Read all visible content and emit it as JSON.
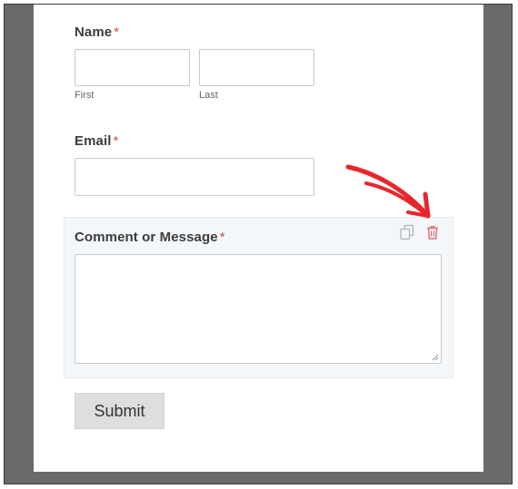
{
  "form": {
    "name": {
      "label": "Name",
      "required_mark": "*",
      "first_sublabel": "First",
      "last_sublabel": "Last"
    },
    "email": {
      "label": "Email",
      "required_mark": "*"
    },
    "comment": {
      "label": "Comment or Message",
      "required_mark": "*"
    },
    "submit_label": "Submit"
  },
  "field_actions": {
    "duplicate_icon": "duplicate-icon",
    "delete_icon": "trash-icon"
  },
  "colors": {
    "required": "#d64b4b",
    "delete_icon": "#e06b6b",
    "annotation_arrow": "#e8262b",
    "selected_field_bg": "#f4f7fa"
  }
}
